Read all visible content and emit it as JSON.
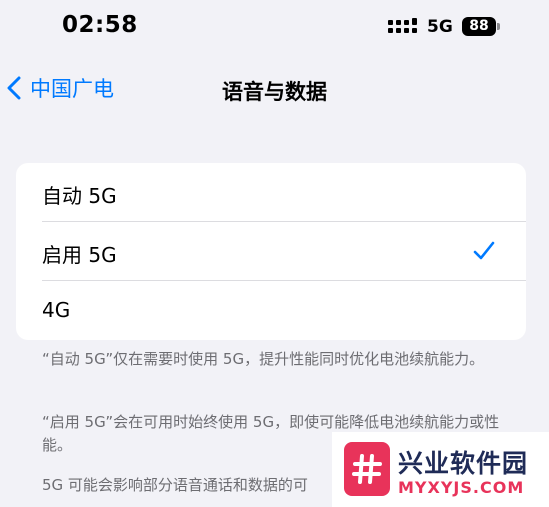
{
  "status_bar": {
    "time": "02:58",
    "network": "5G",
    "battery": "88"
  },
  "nav": {
    "back_label": "中国广电",
    "title": "语音与数据"
  },
  "options": [
    {
      "label": "自动 5G",
      "selected": false
    },
    {
      "label": "启用 5G",
      "selected": true
    },
    {
      "label": "4G",
      "selected": false
    }
  ],
  "notes": [
    "“自动 5G”仅在需要时使用 5G，提升性能同时优化电池续航能力。",
    "“启用 5G”会在可用时始终使用 5G，即使可能降低电池续航能力或性能。",
    "5G 可能会影响部分语音通话和数据的可"
  ],
  "watermark": {
    "title": "兴业软件园",
    "subtitle": "MYXYJS.COM"
  },
  "colors": {
    "accent": "#007aff",
    "background": "#f2f2f7",
    "secondary_text": "#6d6d72",
    "watermark_pink": "#e8335a",
    "watermark_navy": "#1f2b57"
  }
}
